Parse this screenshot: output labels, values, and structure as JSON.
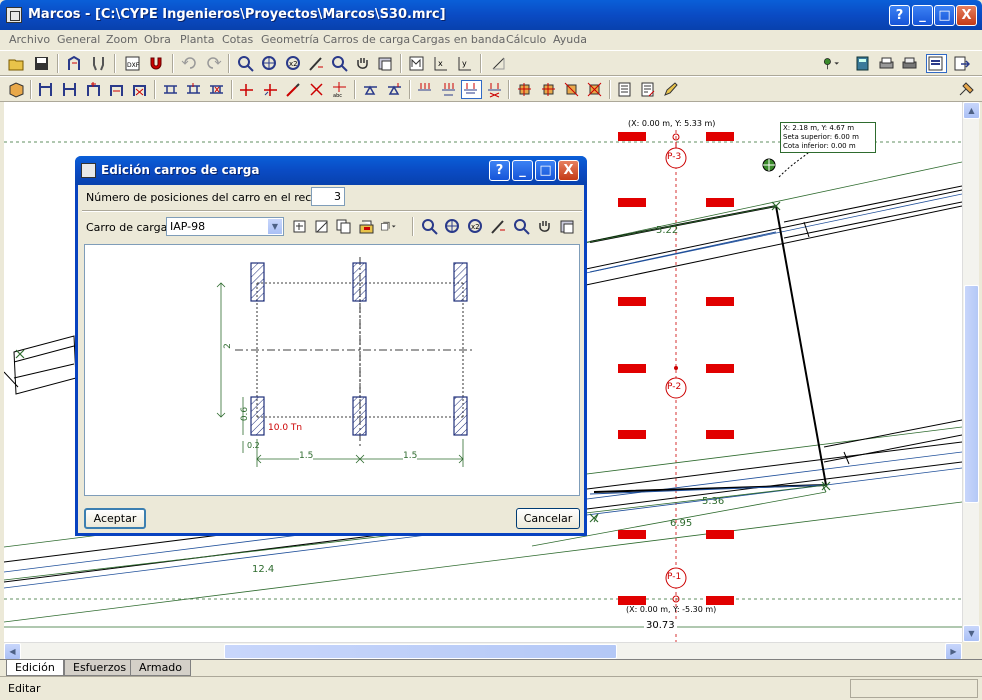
{
  "window": {
    "title": "Marcos - [C:\\CYPE Ingenieros\\Proyectos\\Marcos\\S30.mrc]",
    "help_label": "?",
    "minimize_label": "_",
    "maximize_label": "□",
    "close_label": "X"
  },
  "menu": [
    "Archivo",
    "General",
    "Zoom",
    "Obra",
    "Planta",
    "Cotas",
    "Geometría",
    "Carros de carga",
    "Cargas en banda",
    "Cálculo",
    "Ayuda"
  ],
  "canvas": {
    "coord_top": "(X: 0.00 m, Y: 5.33 m)",
    "coord_bottom": "(X: 0.00 m, Y: -5.30 m)",
    "tooltip": [
      "X: 2.18 m, Y: 4.67 m",
      "Seta superior: 6.00 m",
      "Cota inferior: 0.00 m"
    ],
    "pier_labels": [
      "P-3",
      "P-2",
      "P-1"
    ],
    "dims": [
      "5.22",
      "5.36",
      "6.95",
      "12.4",
      "30.73"
    ]
  },
  "tabs": [
    "Edición",
    "Esfuerzos",
    "Armado"
  ],
  "status": {
    "text": "Editar"
  },
  "dialog": {
    "title": "Edición carros de carga",
    "positions_label": "Número de posiciones del carro en el recorrido",
    "positions_value": "3",
    "truck_label": "Carro de cargas",
    "truck_value": "IAP-98",
    "accept_label": "Aceptar",
    "cancel_label": "Cancelar",
    "drawing": {
      "dim_vertical": "2",
      "dim_wheel": "0.6",
      "dim_small": "0.2",
      "load_label": "10.0 Tn",
      "dim_spacing_1": "1.5",
      "dim_spacing_2": "1.5"
    }
  }
}
